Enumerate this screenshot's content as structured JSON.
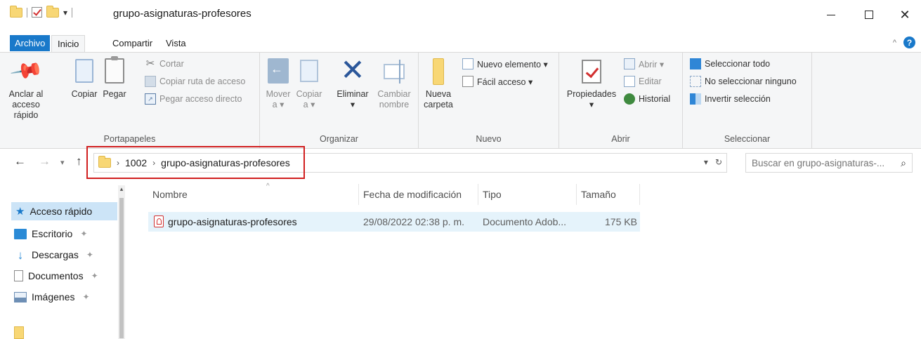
{
  "window": {
    "title": "grupo-asignaturas-profesores",
    "controls": {
      "minimize_icon": "minimize-icon",
      "maximize_icon": "maximize-icon",
      "close_icon": "close-icon"
    }
  },
  "ribbon_tabs": [
    {
      "label": "Archivo",
      "active": false,
      "is_file": true
    },
    {
      "label": "Inicio",
      "active": true
    },
    {
      "label": "Compartir",
      "active": false
    },
    {
      "label": "Vista",
      "active": false
    }
  ],
  "ribbon": {
    "portapapeles": {
      "label": "Portapapeles",
      "pin": "Anclar al acceso rápido",
      "pin_line1": "Anclar al",
      "pin_line2": "acceso rápido",
      "copy": "Copiar",
      "paste": "Pegar",
      "cut": "Cortar",
      "copy_path": "Copiar ruta de acceso",
      "paste_shortcut": "Pegar acceso directo"
    },
    "organizar": {
      "label": "Organizar",
      "move_line1": "Mover",
      "move_line2": "a ▾",
      "copyto_line1": "Copiar",
      "copyto_line2": "a ▾",
      "delete": "Eliminar",
      "delete_dd": "▾",
      "rename_line1": "Cambiar",
      "rename_line2": "nombre"
    },
    "nuevo": {
      "label": "Nuevo",
      "newfolder_line1": "Nueva",
      "newfolder_line2": "carpeta",
      "new_item": "Nuevo elemento ▾",
      "easy_access": "Fácil acceso ▾"
    },
    "abrir": {
      "label": "Abrir",
      "properties": "Propiedades",
      "properties_dd": "▾",
      "open": "Abrir ▾",
      "edit": "Editar",
      "history": "Historial"
    },
    "seleccionar": {
      "label": "Seleccionar",
      "select_all": "Seleccionar todo",
      "select_none": "No seleccionar ninguno",
      "invert": "Invertir selección"
    }
  },
  "address": {
    "breadcrumbs": [
      "1002",
      "grupo-asignaturas-profesores"
    ],
    "search_placeholder": "Buscar en grupo-asignaturas-..."
  },
  "nav_pane": {
    "quick_access": "Acceso rápido",
    "items": [
      {
        "label": "Escritorio",
        "icon": "desktop-icon",
        "pinned": true
      },
      {
        "label": "Descargas",
        "icon": "downloads-icon",
        "pinned": true
      },
      {
        "label": "Documentos",
        "icon": "documents-icon",
        "pinned": true
      },
      {
        "label": "Imágenes",
        "icon": "pictures-icon",
        "pinned": true
      }
    ]
  },
  "columns": [
    "Nombre",
    "Fecha de modificación",
    "Tipo",
    "Tamaño"
  ],
  "files": [
    {
      "name": "grupo-asignaturas-profesores",
      "modified": "29/08/2022 02:38 p. m.",
      "type": "Documento Adob...",
      "size": "175 KB",
      "icon": "pdf-file-icon"
    }
  ],
  "colors": {
    "accent": "#1979ca",
    "selection": "#cce4f7",
    "highlight_box": "#d11f1f"
  }
}
